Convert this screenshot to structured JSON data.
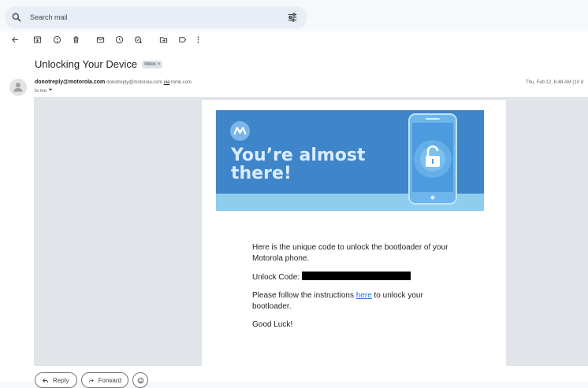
{
  "search": {
    "placeholder": "Search mail"
  },
  "email": {
    "subject": "Unlocking Your Device",
    "label_chip": "Inbox",
    "label_chip_close": "×",
    "sender_name": "donotreply@motorola.com",
    "sender_email": "donotreply@motorola.com",
    "via_word": "via",
    "via_domain": "mmk.com",
    "to": "to me",
    "timestamp": "Thu, Feb 12, 6:48 AM (10 d"
  },
  "banner": {
    "headline_line1": "You’re almost",
    "headline_line2": "there!"
  },
  "body": {
    "intro": "Here is the unique code to unlock the bootloader of your Motorola phone.",
    "unlock_label": "Unlock Code:",
    "instructions_before": "Please follow the instructions ",
    "instructions_link": "here",
    "instructions_after": " to unlock your bootloader.",
    "sign_off": "Good Luck!"
  },
  "actions": {
    "reply_label": "Reply",
    "forward_label": "Forward"
  },
  "colors": {
    "banner_blue": "#3f85c9",
    "banner_stripe": "#8ecdee",
    "link": "#1a73e8",
    "search_bg": "#e9eef6"
  }
}
